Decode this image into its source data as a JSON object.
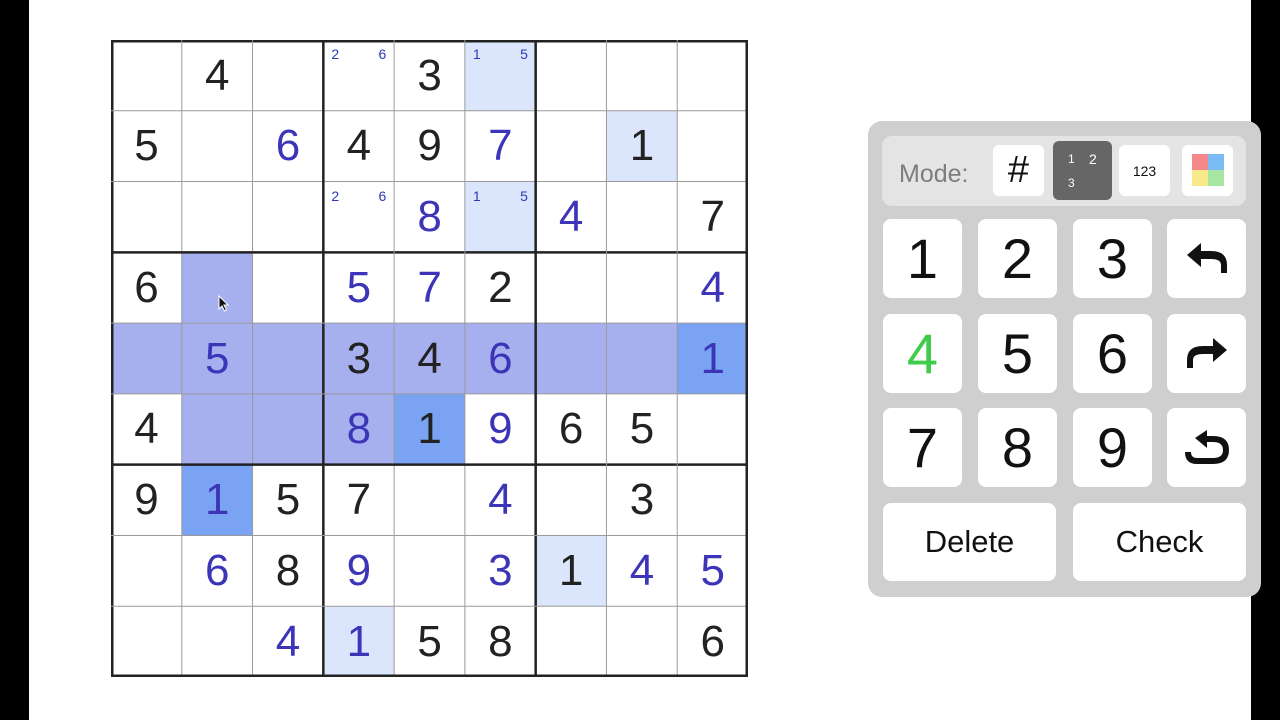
{
  "board": {
    "rows": [
      [
        "",
        "4",
        "",
        "",
        "3",
        "",
        "",
        "",
        ""
      ],
      [
        "5",
        "",
        "6",
        "4",
        "9",
        "7",
        "",
        "1",
        ""
      ],
      [
        "",
        "",
        "",
        "",
        "8",
        "",
        "4",
        "",
        "7"
      ],
      [
        "6",
        "",
        "",
        "5",
        "7",
        "2",
        "",
        "",
        "4"
      ],
      [
        "",
        "5",
        "",
        "3",
        "4",
        "6",
        "",
        "",
        "1"
      ],
      [
        "4",
        "",
        "",
        "8",
        "1",
        "9",
        "6",
        "5",
        ""
      ],
      [
        "9",
        "1",
        "5",
        "7",
        "",
        "4",
        "",
        "3",
        ""
      ],
      [
        "",
        "6",
        "8",
        "9",
        "",
        "3",
        "1",
        "4",
        "5"
      ],
      [
        "",
        "",
        "4",
        "1",
        "5",
        "8",
        "",
        "",
        "6"
      ]
    ],
    "cell_types": [
      [
        "",
        "g",
        "",
        "",
        "g",
        "",
        "",
        "",
        ""
      ],
      [
        "g",
        "",
        "u",
        "g",
        "g",
        "u",
        "",
        "g",
        ""
      ],
      [
        "",
        "",
        "",
        "",
        "u",
        "",
        "u",
        "",
        "g"
      ],
      [
        "g",
        "",
        "",
        "u",
        "u",
        "g",
        "",
        "",
        "u"
      ],
      [
        "",
        "u",
        "",
        "g",
        "g",
        "u",
        "",
        "",
        "u"
      ],
      [
        "g",
        "",
        "",
        "u",
        "g",
        "u",
        "g",
        "g",
        ""
      ],
      [
        "g",
        "u",
        "g",
        "g",
        "",
        "u",
        "",
        "g",
        ""
      ],
      [
        "",
        "u",
        "g",
        "u",
        "",
        "u",
        "g",
        "u",
        "u"
      ],
      [
        "",
        "",
        "u",
        "u",
        "g",
        "g",
        "",
        "",
        "g"
      ]
    ],
    "highlights": [
      [
        "",
        "",
        "",
        "",
        "",
        "L",
        "",
        "",
        ""
      ],
      [
        "",
        "",
        "",
        "",
        "",
        "",
        "",
        "L",
        ""
      ],
      [
        "",
        "",
        "",
        "",
        "",
        "L",
        "",
        "",
        ""
      ],
      [
        "",
        "R",
        "",
        "",
        "",
        "",
        "",
        "",
        ""
      ],
      [
        "R",
        "R",
        "R",
        "R",
        "R",
        "R",
        "R",
        "R",
        "S"
      ],
      [
        "",
        "R",
        "R",
        "R",
        "S",
        "",
        "",
        "",
        ""
      ],
      [
        "",
        "S",
        "",
        "",
        "",
        "",
        "",
        "",
        ""
      ],
      [
        "",
        "",
        "",
        "",
        "",
        "",
        "L",
        "",
        ""
      ],
      [
        "",
        "",
        "",
        "L",
        "",
        "",
        "",
        "",
        ""
      ]
    ],
    "notes": [
      {
        "row": 0,
        "col": 3,
        "left": "2",
        "right": "6"
      },
      {
        "row": 0,
        "col": 5,
        "left": "1",
        "right": "5"
      },
      {
        "row": 2,
        "col": 3,
        "left": "2",
        "right": "6"
      },
      {
        "row": 2,
        "col": 5,
        "left": "1",
        "right": "5"
      }
    ],
    "colors": {
      "given": "#222222",
      "user": "#3c35b8",
      "highlight_light": "#dbe5fb",
      "highlight_row": "#a6b0ef",
      "highlight_selected": "#7aa4f3"
    }
  },
  "keypad": {
    "mode_label": "Mode:",
    "modes": {
      "digit": "#",
      "candidates": [
        "1",
        "2",
        "3"
      ],
      "numbers": "123",
      "color_swatches": [
        "#f4888a",
        "#7cbcf4",
        "#f8e98a",
        "#a8e6a4"
      ]
    },
    "digit_keys": [
      "1",
      "2",
      "3",
      "4",
      "5",
      "6",
      "7",
      "8",
      "9"
    ],
    "highlight_key_color": "#3fcc4a",
    "icons": [
      "undo-icon",
      "redo-icon",
      "restart-icon"
    ],
    "delete_label": "Delete",
    "check_label": "Check"
  }
}
